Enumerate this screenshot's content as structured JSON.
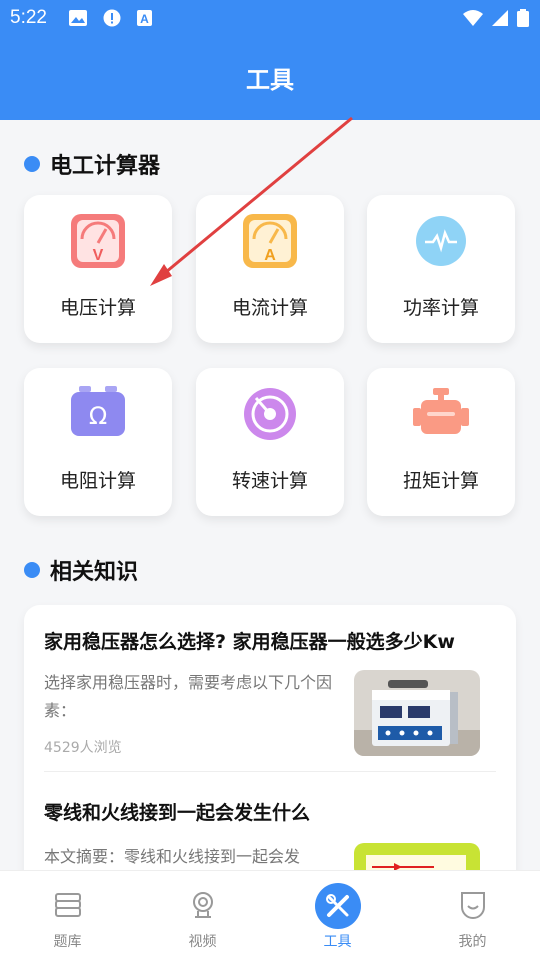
{
  "status_bar": {
    "time": "5:22",
    "icons": [
      "image-icon",
      "alert-icon",
      "a-icon",
      "wifi-icon",
      "signal-icon",
      "battery-icon"
    ]
  },
  "header": {
    "title": "工具"
  },
  "calculators": {
    "section_title": "电工计算器",
    "items": [
      {
        "label": "电压计算",
        "icon": "voltmeter-icon"
      },
      {
        "label": "电流计算",
        "icon": "ammeter-icon"
      },
      {
        "label": "功率计算",
        "icon": "power-icon"
      },
      {
        "label": "电阻计算",
        "icon": "resistor-icon"
      },
      {
        "label": "转速计算",
        "icon": "speed-icon"
      },
      {
        "label": "扭矩计算",
        "icon": "motor-icon"
      }
    ]
  },
  "knowledge": {
    "section_title": "相关知识",
    "articles": [
      {
        "title": "家用稳压器怎么选择? 家用稳压器一般选多少Kw",
        "summary": "选择家用稳压器时，需要考虑以下几个因素：",
        "views": "4529人浏览"
      },
      {
        "title": "零线和火线接到一起会发生什么",
        "summary": "本文摘要：零线和火线接到一起会发",
        "views": ""
      }
    ]
  },
  "bottom_nav": {
    "items": [
      {
        "label": "题库",
        "icon": "question-bank-icon"
      },
      {
        "label": "视频",
        "icon": "video-icon"
      },
      {
        "label": "工具",
        "icon": "tools-icon",
        "active": true
      },
      {
        "label": "我的",
        "icon": "profile-icon"
      }
    ]
  },
  "colors": {
    "accent": "#3a8cf5",
    "annotation_arrow": "#e04040"
  }
}
